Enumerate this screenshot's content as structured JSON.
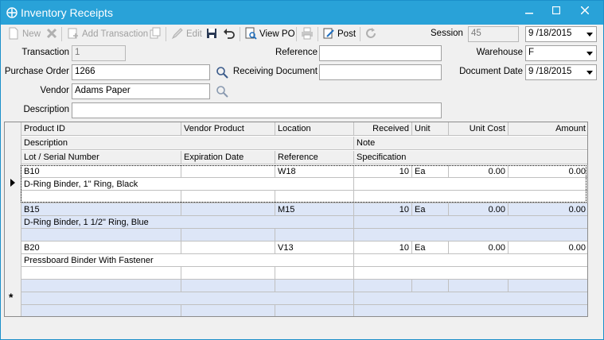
{
  "window": {
    "title": "Inventory Receipts",
    "app_icon": "app-logo-icon",
    "controls": [
      "minimize-icon",
      "maximize-icon",
      "close-icon"
    ]
  },
  "toolbar": {
    "new_label": "New",
    "add_transaction_label": "Add Transaction",
    "edit_label": "Edit",
    "view_po_label": "View PO",
    "post_label": "Post",
    "session_label": "Session",
    "session_value": "45",
    "session_date": "9 /18/2015"
  },
  "form": {
    "transaction_label": "Transaction",
    "transaction_value": "1",
    "reference_label": "Reference",
    "reference_value": "",
    "warehouse_label": "Warehouse",
    "warehouse_value": "F",
    "purchase_order_label": "Purchase Order",
    "purchase_order_value": "1266",
    "receiving_document_label": "Receiving Document",
    "receiving_document_value": "",
    "document_date_label": "Document Date",
    "document_date_value": "9 /18/2015",
    "vendor_label": "Vendor",
    "vendor_value": "Adams Paper",
    "description_label": "Description",
    "description_value": ""
  },
  "grid": {
    "headers": {
      "row1": [
        "Product ID",
        "Vendor Product",
        "Location",
        "Received",
        "Unit",
        "Unit Cost",
        "Amount"
      ],
      "row2": [
        "Description",
        "Note"
      ],
      "row3": [
        "Lot / Serial Number",
        "Expiration Date",
        "Reference",
        "Specification"
      ]
    },
    "rows": [
      {
        "product_id": "B10",
        "vendor_product": "",
        "location": "W18",
        "received": "10",
        "unit": "Ea",
        "unit_cost": "0.00",
        "amount": "0.00",
        "description": "D-Ring Binder, 1\" Ring, Black"
      },
      {
        "product_id": "B15",
        "vendor_product": "",
        "location": "M15",
        "received": "10",
        "unit": "Ea",
        "unit_cost": "0.00",
        "amount": "0.00",
        "description": "D-Ring Binder, 1 1/2\" Ring, Blue"
      },
      {
        "product_id": "B20",
        "vendor_product": "",
        "location": "V13",
        "received": "10",
        "unit": "Ea",
        "unit_cost": "0.00",
        "amount": "0.00",
        "description": "Pressboard Binder With Fastener"
      }
    ],
    "new_row_marker": "*"
  }
}
